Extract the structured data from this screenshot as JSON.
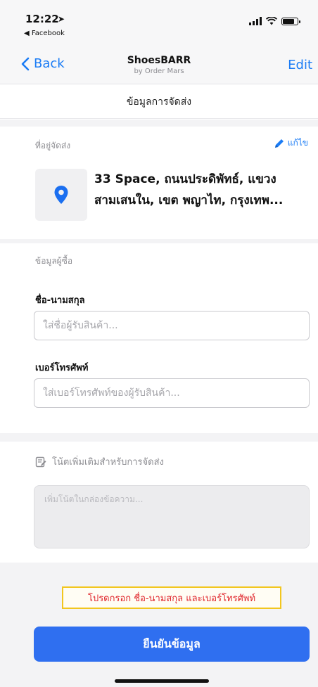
{
  "status_bar": {
    "time": "12:22",
    "location_glyph": "➤",
    "back_to_app": "◀ Facebook"
  },
  "nav": {
    "back_label": "Back",
    "title": "ShoesBARR",
    "subtitle": "by Order Mars",
    "edit_label": "Edit"
  },
  "section_title": "ข้อมูลการจัดส่ง",
  "address": {
    "label": "ที่อยู่จัดส่ง",
    "edit_label": "แก้ไข",
    "text": "33 Space, ถนนประดิพัทธ์, แขวงสามเสนใน, เขต พญาไท, กรุงเทพ..."
  },
  "buyer": {
    "label": "ข้อมูลผู้ซื้อ",
    "name_label": "ชื่อ-นามสกุล",
    "name_placeholder": "ใส่ชื่อผู้รับสินค้า...",
    "name_value": "",
    "phone_label": "เบอร์โทรศัพท์",
    "phone_placeholder": "ใส่เบอร์โทรศัพท์ของผู้รับสินค้า...",
    "phone_value": ""
  },
  "notes": {
    "label": "โน้ตเพิ่มเติมสำหรับการจัดส่ง",
    "placeholder": "เพิ่มโน้ตในกล่องข้อความ..."
  },
  "warning_text": "โปรดกรอก ชื่อ-นามสกุล และเบอร์โทรศัพท์",
  "confirm_label": "ยืนยันข้อมูล",
  "colors": {
    "accent": "#1b7cf5",
    "button": "#2f6ff0",
    "warning_text": "#e0272d",
    "warning_border": "#f2c61f"
  }
}
